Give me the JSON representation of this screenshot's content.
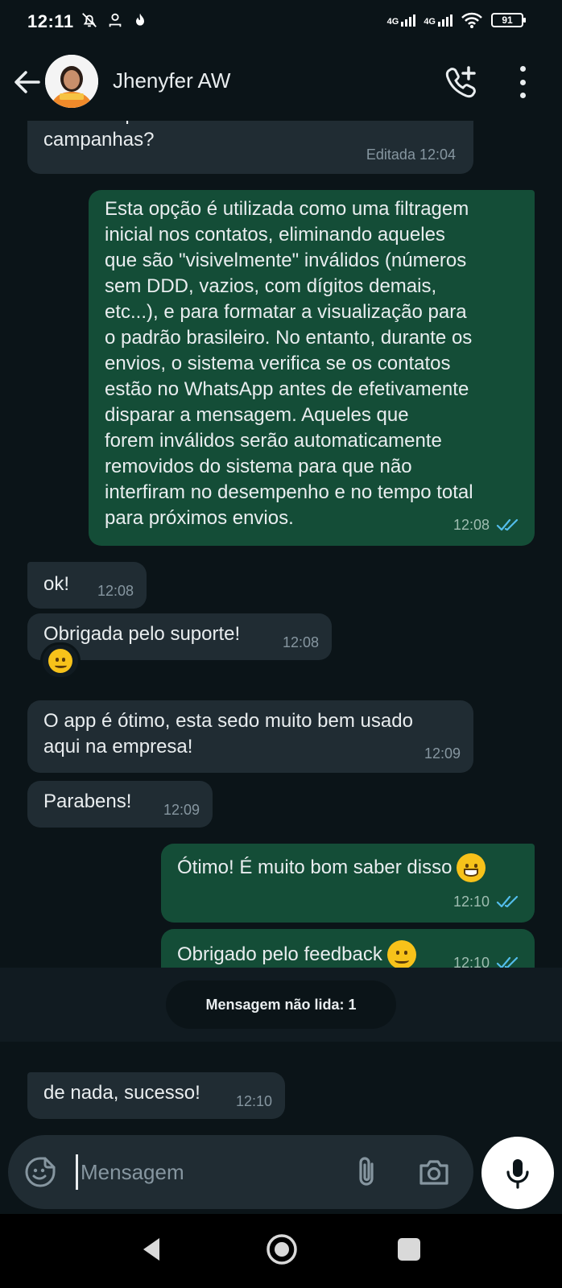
{
  "status_bar": {
    "time": "12:11",
    "signal1_label": "4G",
    "signal2_label": "4G",
    "battery": "91"
  },
  "header": {
    "contact_name": "Jhenyfer AW"
  },
  "messages": [
    {
      "id": "m0",
      "dir": "in",
      "text": "de sofrer problemas futuros com minhas\ncampanhas?",
      "time": "Editada 12:04"
    },
    {
      "id": "m1",
      "dir": "out",
      "text": "Esta opção é utilizada como uma filtragem\ninicial nos contatos, eliminando aqueles\nque são \"visivelmente\" inválidos (números\nsem DDD, vazios, com dígitos demais,\netc...), e para formatar a visualização para\no padrão brasileiro. No entanto, durante os\nenvios, o sistema verifica se os contatos\nestão no WhatsApp antes de efetivamente\ndisparar a mensagem. Aqueles que\nforem inválidos serão automaticamente\nremovidos do sistema para que não\ninterfiram no desempenho e no tempo total\npara próximos envios.",
      "time": "12:08"
    },
    {
      "id": "m2",
      "dir": "in",
      "text": "ok!",
      "time": "12:08"
    },
    {
      "id": "m3",
      "dir": "in",
      "text": "Obrigada pelo suporte!",
      "time": "12:08"
    },
    {
      "id": "m4",
      "dir": "in",
      "text": "O app é ótimo, esta sedo muito bem usado\naqui na empresa!",
      "time": "12:09"
    },
    {
      "id": "m5",
      "dir": "in",
      "text": "Parabens!",
      "time": "12:09"
    },
    {
      "id": "m6",
      "dir": "out",
      "text": "Ótimo! É muito bom saber disso",
      "time": "12:10"
    },
    {
      "id": "m7",
      "dir": "out",
      "text": "Obrigado pelo feedback",
      "time": "12:10"
    },
    {
      "id": "m8",
      "dir": "in",
      "text": "de nada, sucesso!",
      "time": "12:10"
    }
  ],
  "reaction_icon": "winking-smile-emoji",
  "unread_divider": "Mensagem não lida: 1",
  "input": {
    "placeholder": "Mensagem"
  },
  "colors": {
    "background": "#0b1418",
    "incoming_bubble": "#202c33",
    "outgoing_bubble": "#144d37",
    "read_ticks": "#53bdeb"
  }
}
